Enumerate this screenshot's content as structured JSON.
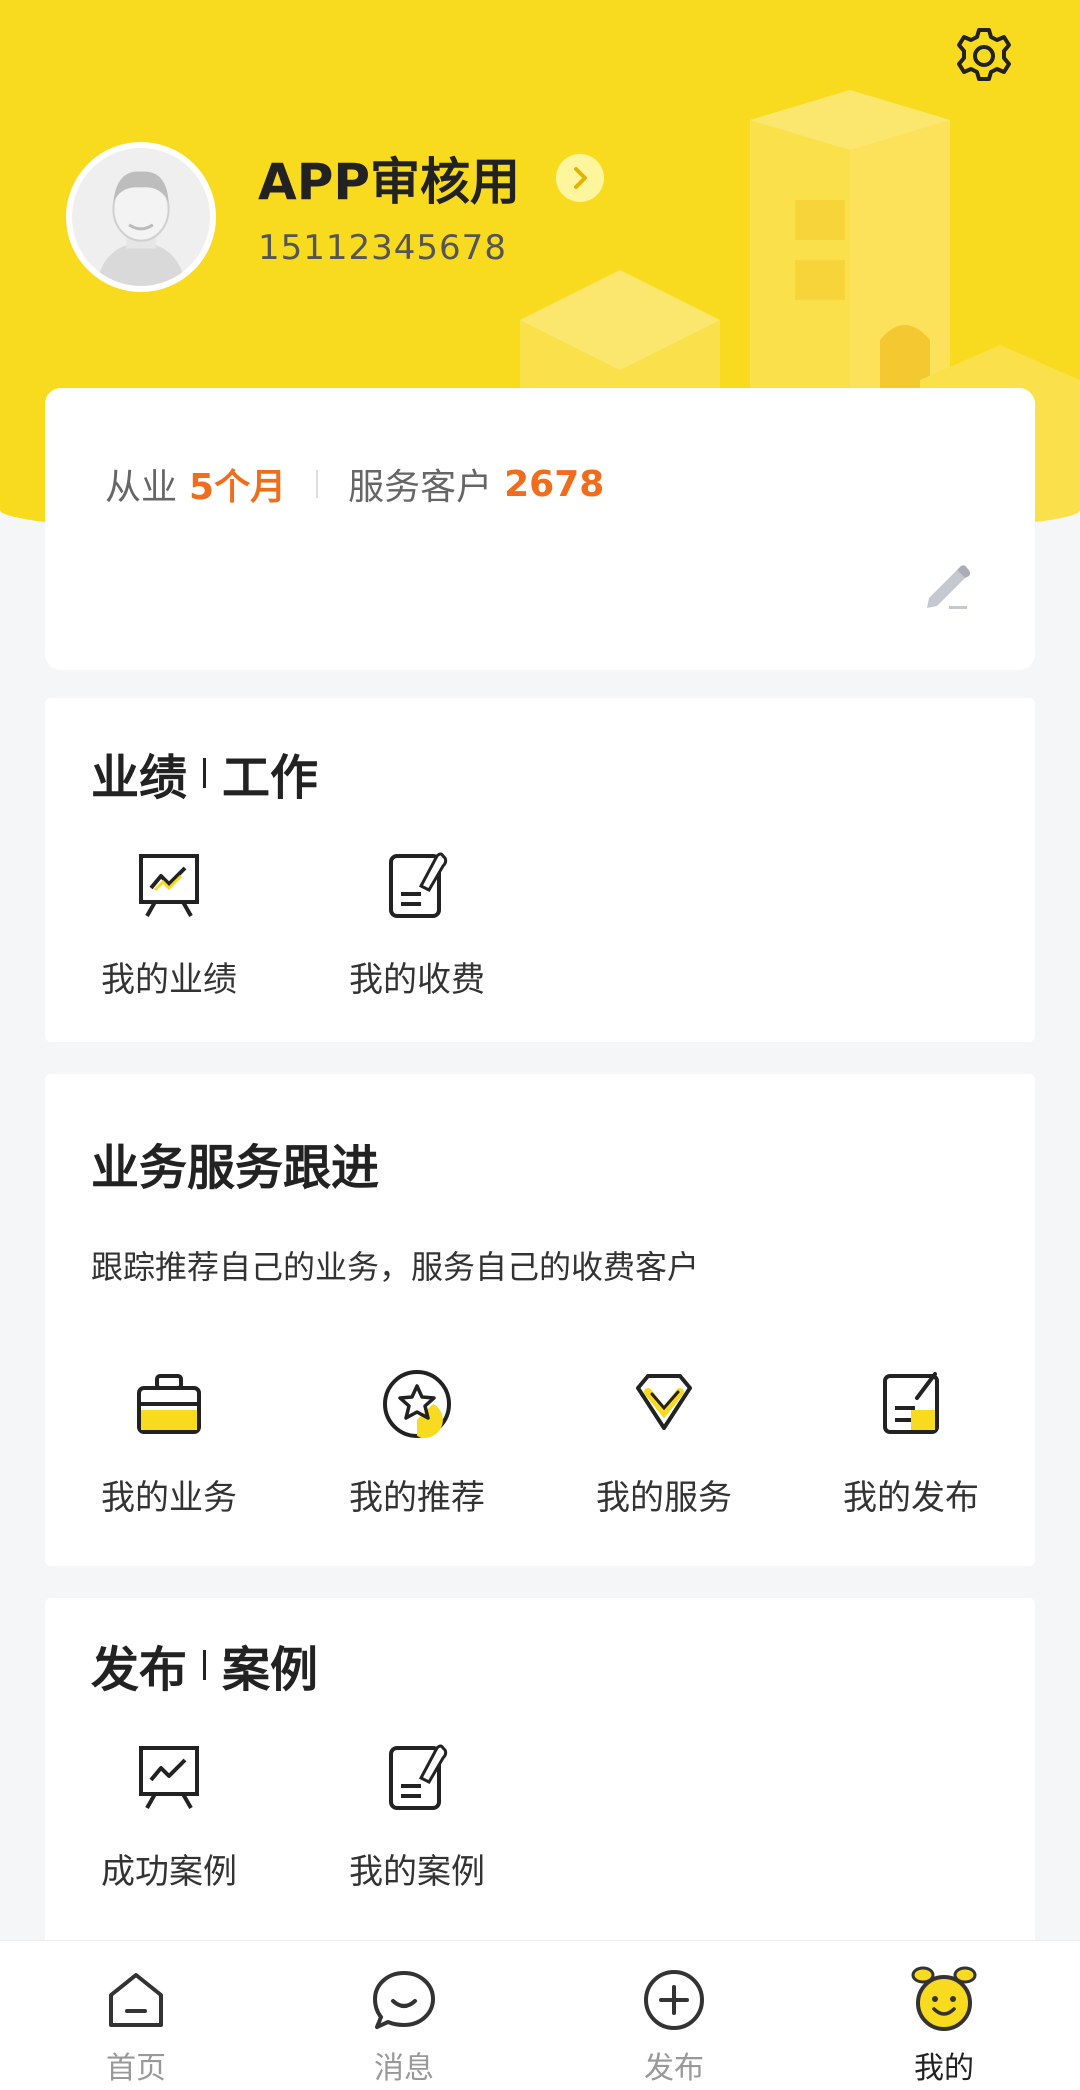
{
  "colors": {
    "brand_yellow": "#f8da1f",
    "accent_orange": "#f06d1e",
    "page_bg": "#f5f6f8"
  },
  "profile": {
    "name": "APP审核用",
    "phone": "15112345678",
    "icons": [
      "settings-icon",
      "avatar",
      "chevron-right-icon"
    ]
  },
  "stats": {
    "tenure_label": "从业",
    "tenure_value": "5个月",
    "clients_label": "服务客户",
    "clients_value": "2678",
    "edit_icon": "pencil-icon"
  },
  "performance": {
    "title_a": "业绩",
    "title_b": "工作",
    "items": [
      {
        "label": "我的业绩",
        "icon": "chart-board-icon"
      },
      {
        "label": "我的收费",
        "icon": "document-edit-icon"
      }
    ]
  },
  "service": {
    "title": "业务服务跟进",
    "subtitle": "跟踪推荐自己的业务，服务自己的收费客户",
    "items": [
      {
        "label": "我的业务",
        "icon": "briefcase-icon"
      },
      {
        "label": "我的推荐",
        "icon": "star-badge-icon"
      },
      {
        "label": "我的服务",
        "icon": "diamond-check-icon"
      },
      {
        "label": "我的发布",
        "icon": "publish-edit-icon"
      }
    ]
  },
  "cases": {
    "title_a": "发布",
    "title_b": "案例",
    "items": [
      {
        "label": "成功案例",
        "icon": "chart-board-icon"
      },
      {
        "label": "我的案例",
        "icon": "document-edit-icon"
      }
    ]
  },
  "tabbar": [
    {
      "label": "首页",
      "icon": "home-icon",
      "active": false
    },
    {
      "label": "消息",
      "icon": "chat-icon",
      "active": false
    },
    {
      "label": "发布",
      "icon": "plus-circle-icon",
      "active": false
    },
    {
      "label": "我的",
      "icon": "smiley-icon",
      "active": true
    }
  ]
}
